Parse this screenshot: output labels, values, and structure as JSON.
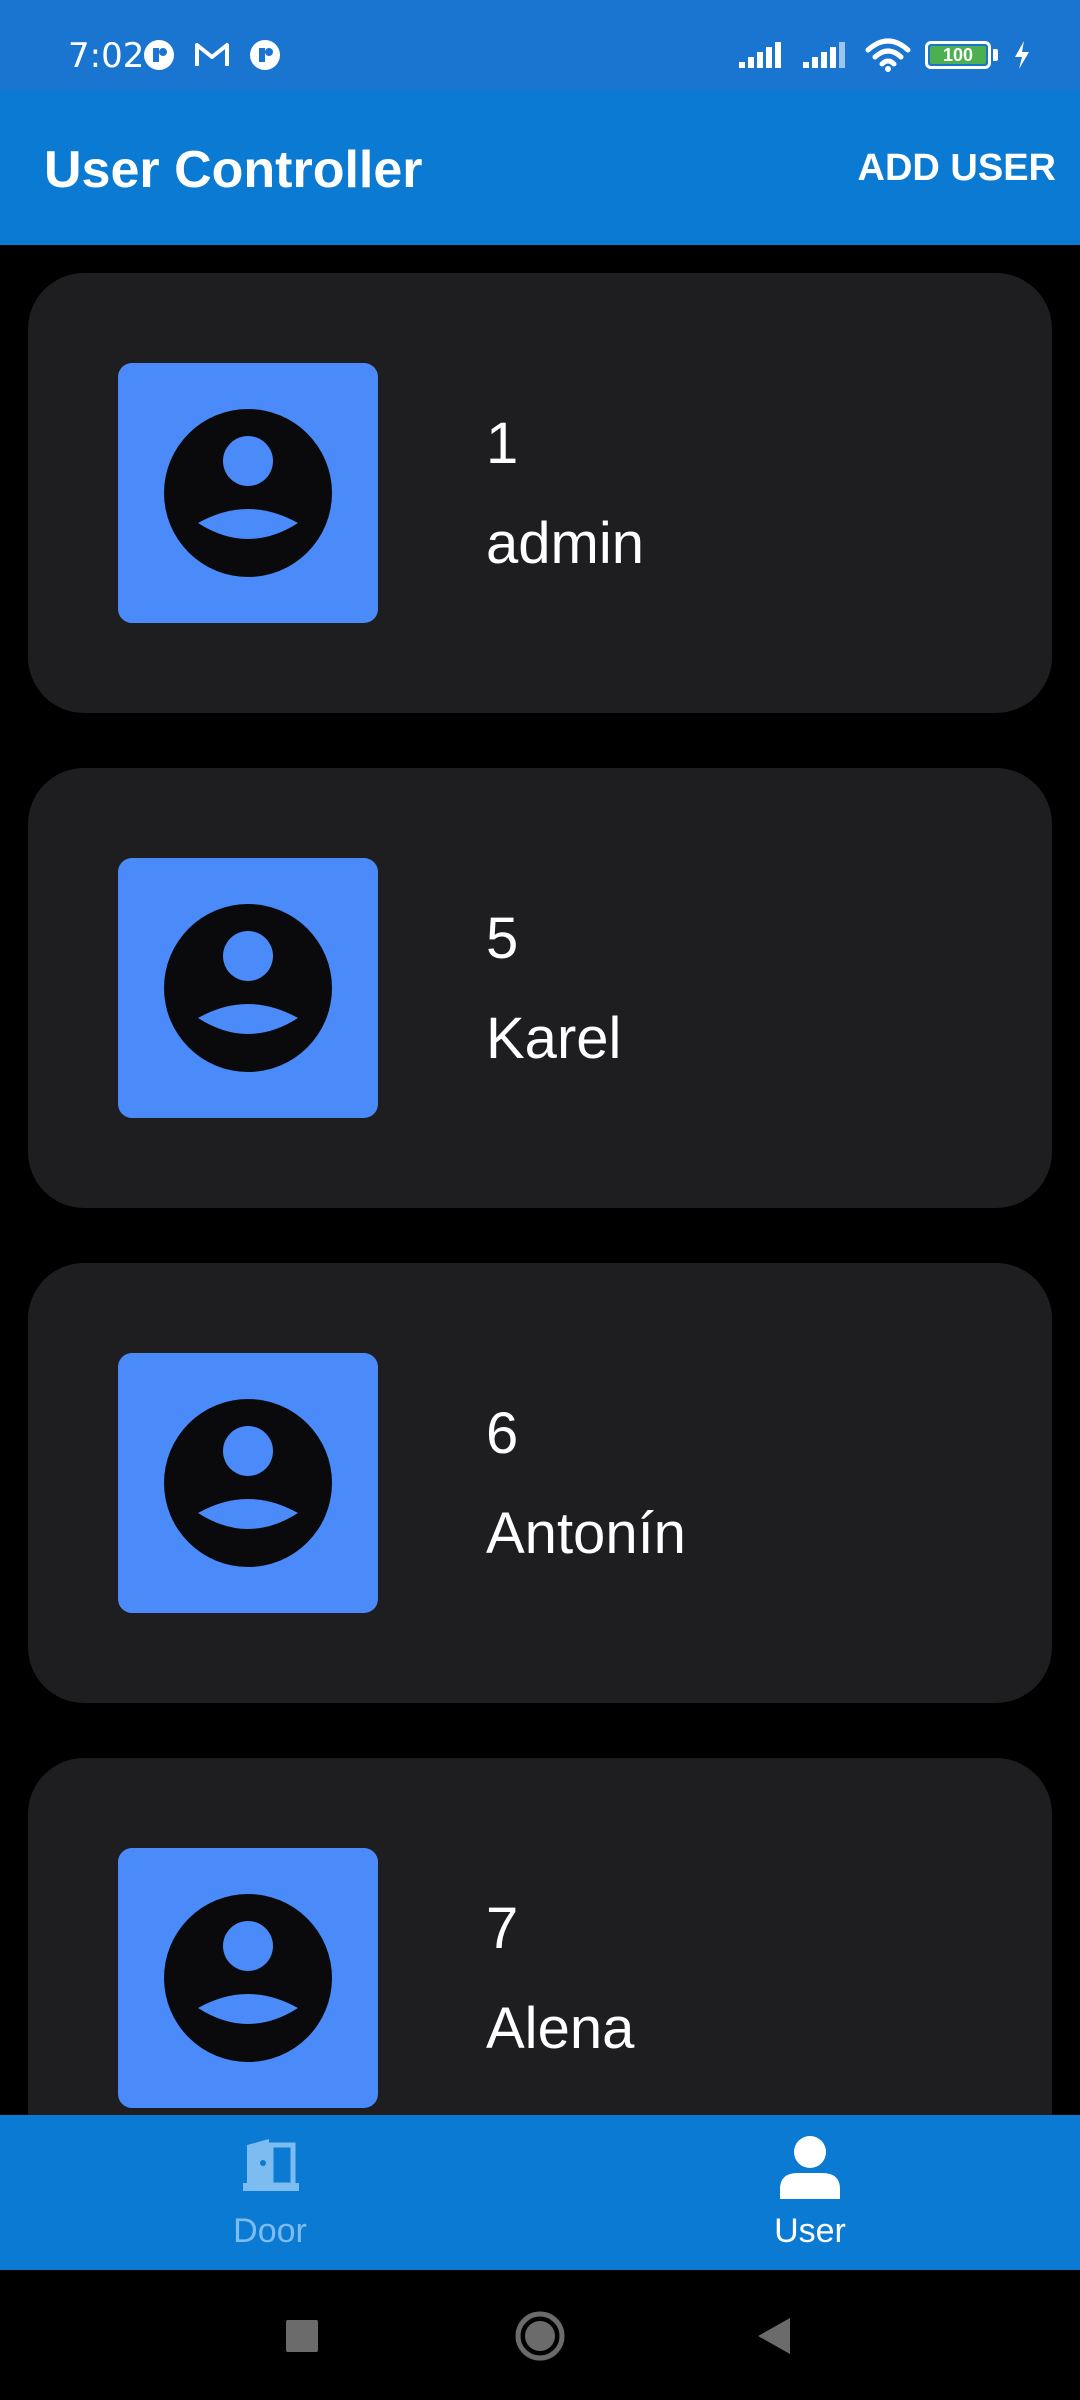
{
  "status_bar": {
    "time": "7:02",
    "battery_level": "100",
    "left_icons": [
      "messenger-icon",
      "gmail-icon",
      "messenger-icon"
    ],
    "right_icons": [
      "signal-icon",
      "signal-icon",
      "wifi-icon",
      "battery-icon",
      "charging-icon"
    ]
  },
  "app_bar": {
    "title": "User Controller",
    "action_label": "ADD USER"
  },
  "users": [
    {
      "id": "1",
      "name": "admin"
    },
    {
      "id": "5",
      "name": "Karel"
    },
    {
      "id": "6",
      "name": "Antonín"
    },
    {
      "id": "7",
      "name": "Alena"
    }
  ],
  "bottom_nav": {
    "items": [
      {
        "label": "Door",
        "icon": "door-icon",
        "selected": false
      },
      {
        "label": "User",
        "icon": "user-icon",
        "selected": true
      }
    ]
  },
  "colors": {
    "status_bar": "#1a75d1",
    "app_bar": "#0a7ad3",
    "card": "#1e1e20",
    "avatar_bg": "#4a8af9",
    "inactive_nav": "#7dbcf0"
  }
}
